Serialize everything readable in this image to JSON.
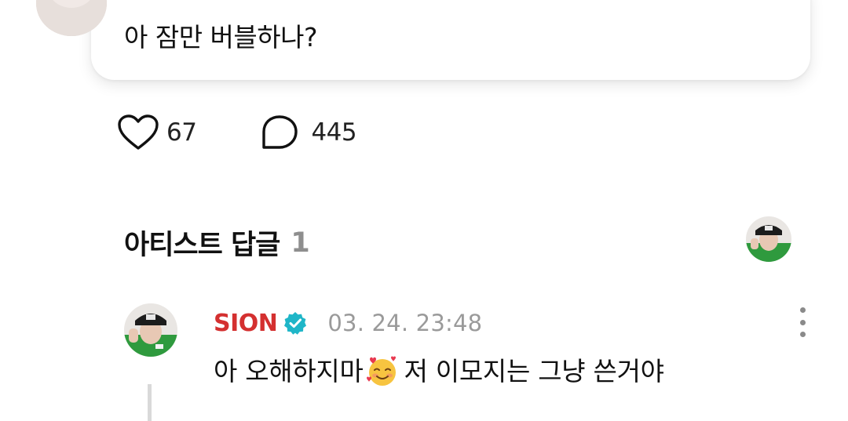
{
  "comment": {
    "text": "아 잠만 버블하나?"
  },
  "actions": {
    "likes_count": "67",
    "comments_count": "445"
  },
  "artist_replies": {
    "title": "아티스트 답글",
    "count": "1"
  },
  "reply": {
    "author": "SION",
    "timestamp": "03. 24. 23:48",
    "text_before_emoji": "아 오해하지마",
    "emoji": "smiling-face-with-hearts",
    "text_after_emoji": "저 이모지는 그냥 쓴거야"
  },
  "colors": {
    "author_name": "#d43030",
    "verified_badge": "#1fb6c8",
    "muted_text": "#9a9a9a",
    "section_count": "#8e8e8e"
  },
  "icons": {
    "like": "heart-outline-icon",
    "comment": "speech-bubble-icon",
    "verified": "verified-badge-icon",
    "more": "more-vertical-icon"
  }
}
